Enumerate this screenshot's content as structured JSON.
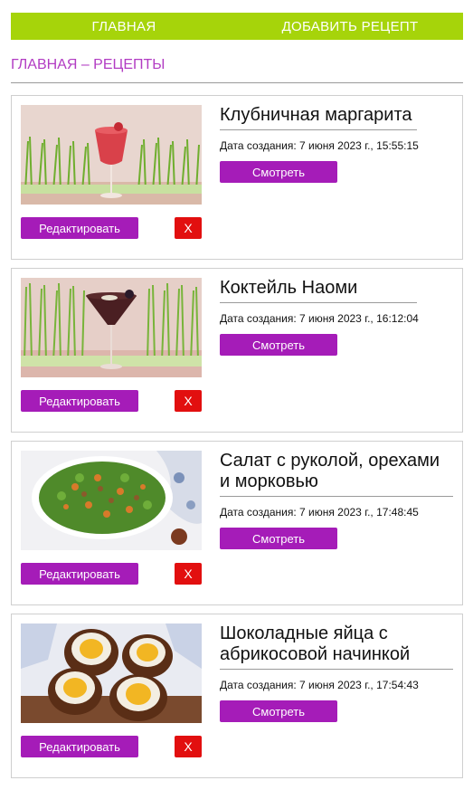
{
  "nav": {
    "home_label": "ГЛАВНАЯ",
    "add_label": "ДОБАВИТЬ РЕЦЕПТ"
  },
  "page_title": "ГЛАВНАЯ – РЕЦЕПТЫ",
  "colors": {
    "nav_bg": "#a6d40a",
    "title_color": "#b23cc3",
    "action_button": "#a51cb8",
    "delete_button": "#e20f0f"
  },
  "recipes": [
    {
      "title": "Клубничная маргарита",
      "date": "Дата создания: 7 июня 2023 г., 15:55:15",
      "view_label": "Смотреть",
      "edit_label": "Редактировать",
      "delete_label": "X"
    },
    {
      "title": "Коктейль Наоми",
      "date": "Дата создания: 7 июня 2023 г., 16:12:04",
      "view_label": "Смотреть",
      "edit_label": "Редактировать",
      "delete_label": "X"
    },
    {
      "title": "Салат с руколой, орехами и морковью",
      "date": "Дата создания: 7 июня 2023 г., 17:48:45",
      "view_label": "Смотреть",
      "edit_label": "Редактировать",
      "delete_label": "X"
    },
    {
      "title": "Шоколадные яйца с абрикосовой начинкой",
      "date": "Дата создания: 7 июня 2023 г., 17:54:43",
      "view_label": "Смотреть",
      "edit_label": "Редактировать",
      "delete_label": "X"
    }
  ]
}
